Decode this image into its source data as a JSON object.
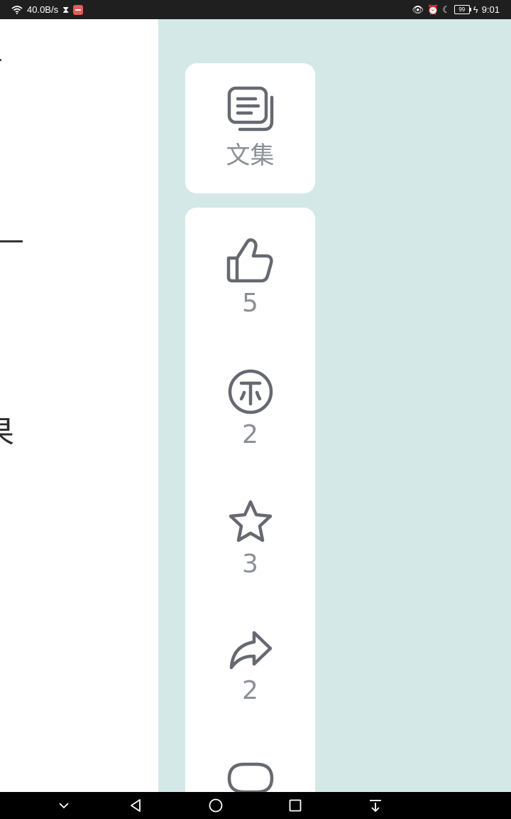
{
  "status_bar": {
    "net_speed": "40.0B/s",
    "battery": "99",
    "time": "9:01"
  },
  "article": {
    "visible_fragment": "果"
  },
  "actions": {
    "collection_label": "文集",
    "like_count": "5",
    "coin_count": "2",
    "favorite_count": "3",
    "share_count": "2"
  },
  "colors": {
    "background": "#d4e8e7",
    "icon": "#666a70",
    "count_text": "#8b9096"
  }
}
